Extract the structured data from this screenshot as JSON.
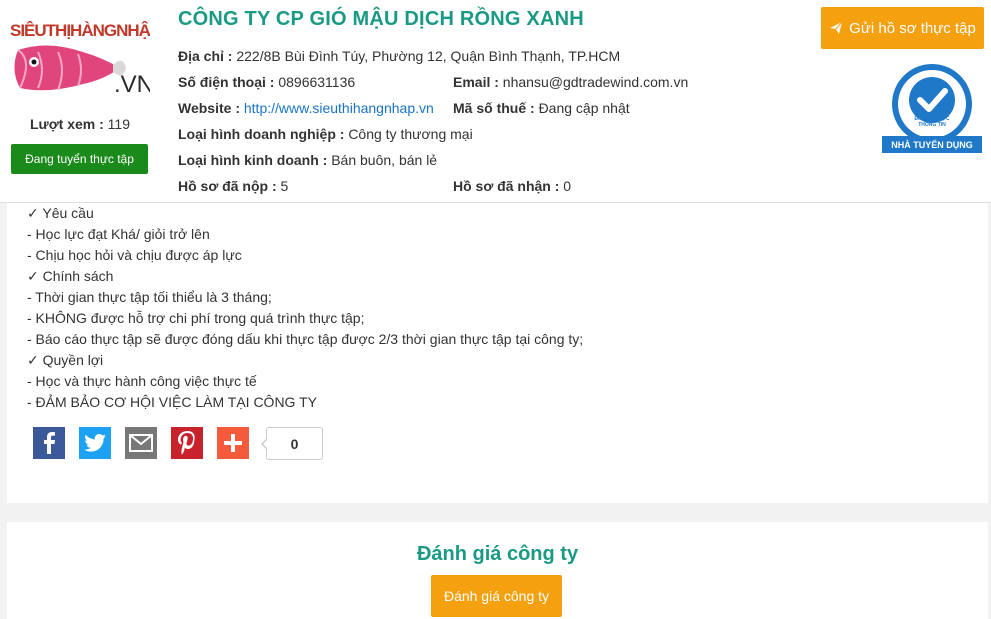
{
  "sidebar": {
    "logo_text": "SIÊUTHỊHÀNGNHẬP",
    "logo_suffix": ".VN",
    "views_label": "Lượt xem :",
    "views_value": "119",
    "recruit_button": "Đang tuyển thực tập"
  },
  "company": {
    "name": "CÔNG TY CP GIÓ MẬU DỊCH RỒNG XANH",
    "address_label": "Địa chỉ :",
    "address_value": "222/8B Bùi Đình Túy, Phường 12, Quận Bình Thạnh, TP.HCM",
    "phone_label": "Số điện thoại :",
    "phone_value": "0896631136",
    "email_label": "Email :",
    "email_value": "nhansu@gdtradewind.com.vn",
    "website_label": "Website :",
    "website_value": "http://www.sieuthihangnhap.vn",
    "tax_label": "Mã số thuế :",
    "tax_value": "Đang cập nhật",
    "biz_type_label": "Loại hình doanh nghiệp :",
    "biz_type_value": "Công ty thương mại",
    "trade_type_label": "Loại hình kinh doanh :",
    "trade_type_value": "Bán buôn, bán lẻ",
    "submitted_label": "Hồ sơ đã nộp :",
    "submitted_value": "5",
    "received_label": "Hồ sơ đã nhận :",
    "received_value": "0"
  },
  "actions": {
    "apply_button": "Gửi hồ sơ thực tập"
  },
  "badge": {
    "line1": "ĐÃ XÁC THỰC",
    "line2": "THÔNG TIN",
    "line3": "NHÀ TUYỂN DỤNG"
  },
  "content": {
    "lines": [
      "✓ Yêu cầu",
      "- Học lực đạt Khá/ giỏi trở lên",
      "- Chịu học hỏi và chịu được áp lực",
      "✓ Chính sách",
      "- Thời gian thực tập tối thiểu là 3 tháng;",
      "- KHÔNG được hỗ trợ chi phí trong quá trình thực tập;",
      "- Báo cáo thực tập sẽ được đóng dấu khi thực tập được 2/3 thời gian thực tập tại công ty;",
      "✓ Quyền lợi",
      "- Học và thực hành công việc thực tế",
      "- ĐẢM BẢO CƠ HỘI VIỆC LÀM TẠI CÔNG TY"
    ]
  },
  "share": {
    "count": "0",
    "icons": [
      "facebook-icon",
      "twitter-icon",
      "email-icon",
      "pinterest-icon",
      "plus-icon"
    ],
    "colors": {
      "facebook": "#3b5998",
      "twitter": "#1da1f2",
      "email": "#777777",
      "pinterest": "#c8232c",
      "plus": "#f65a3c"
    }
  },
  "review": {
    "title": "Đánh giá công ty",
    "button": "Đánh giá công ty"
  },
  "colors": {
    "accent_teal": "#1a9a84",
    "accent_orange": "#f5a00f",
    "recruit_green": "#1a8a1a",
    "badge_blue": "#1f78c8"
  }
}
